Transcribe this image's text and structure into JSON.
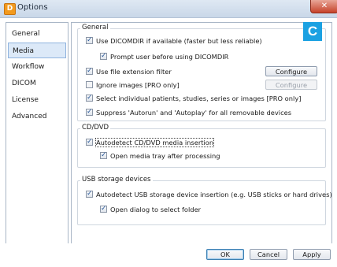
{
  "window": {
    "title": "Options",
    "app_icon_letter": "D",
    "close_symbol": "✕"
  },
  "badge": {
    "letter": "C",
    "color": "#1ba1e2"
  },
  "sidebar": {
    "items": [
      {
        "label": "General",
        "selected": false
      },
      {
        "label": "Media",
        "selected": true
      },
      {
        "label": "Workflow",
        "selected": false
      },
      {
        "label": "DICOM",
        "selected": false
      },
      {
        "label": "License",
        "selected": false
      },
      {
        "label": "Advanced",
        "selected": false
      }
    ]
  },
  "general": {
    "title": "General",
    "use_dicomdir": "Use DICOMDIR if available (faster but less reliable)",
    "prompt_dicomdir": "Prompt user before using DICOMDIR",
    "file_ext_filter": "Use file extension filter",
    "ignore_images": "Ignore images [PRO only]",
    "select_individual": "Select individual patients, studies, series or images [PRO only]",
    "suppress_autorun": "Suppress 'Autorun' and 'Autoplay' for all removable devices",
    "configure_1": "Configure",
    "configure_2": "Configure"
  },
  "cddvd": {
    "title": "CD/DVD",
    "autodetect": "Autodetect CD/DVD media insertion",
    "open_tray": "Open media tray after processing"
  },
  "usb": {
    "title": "USB storage devices",
    "autodetect": "Autodetect USB storage device insertion (e.g. USB sticks or hard drives)",
    "open_dialog": "Open dialog to select folder"
  },
  "buttons": {
    "ok": "OK",
    "cancel": "Cancel",
    "apply": "Apply"
  }
}
